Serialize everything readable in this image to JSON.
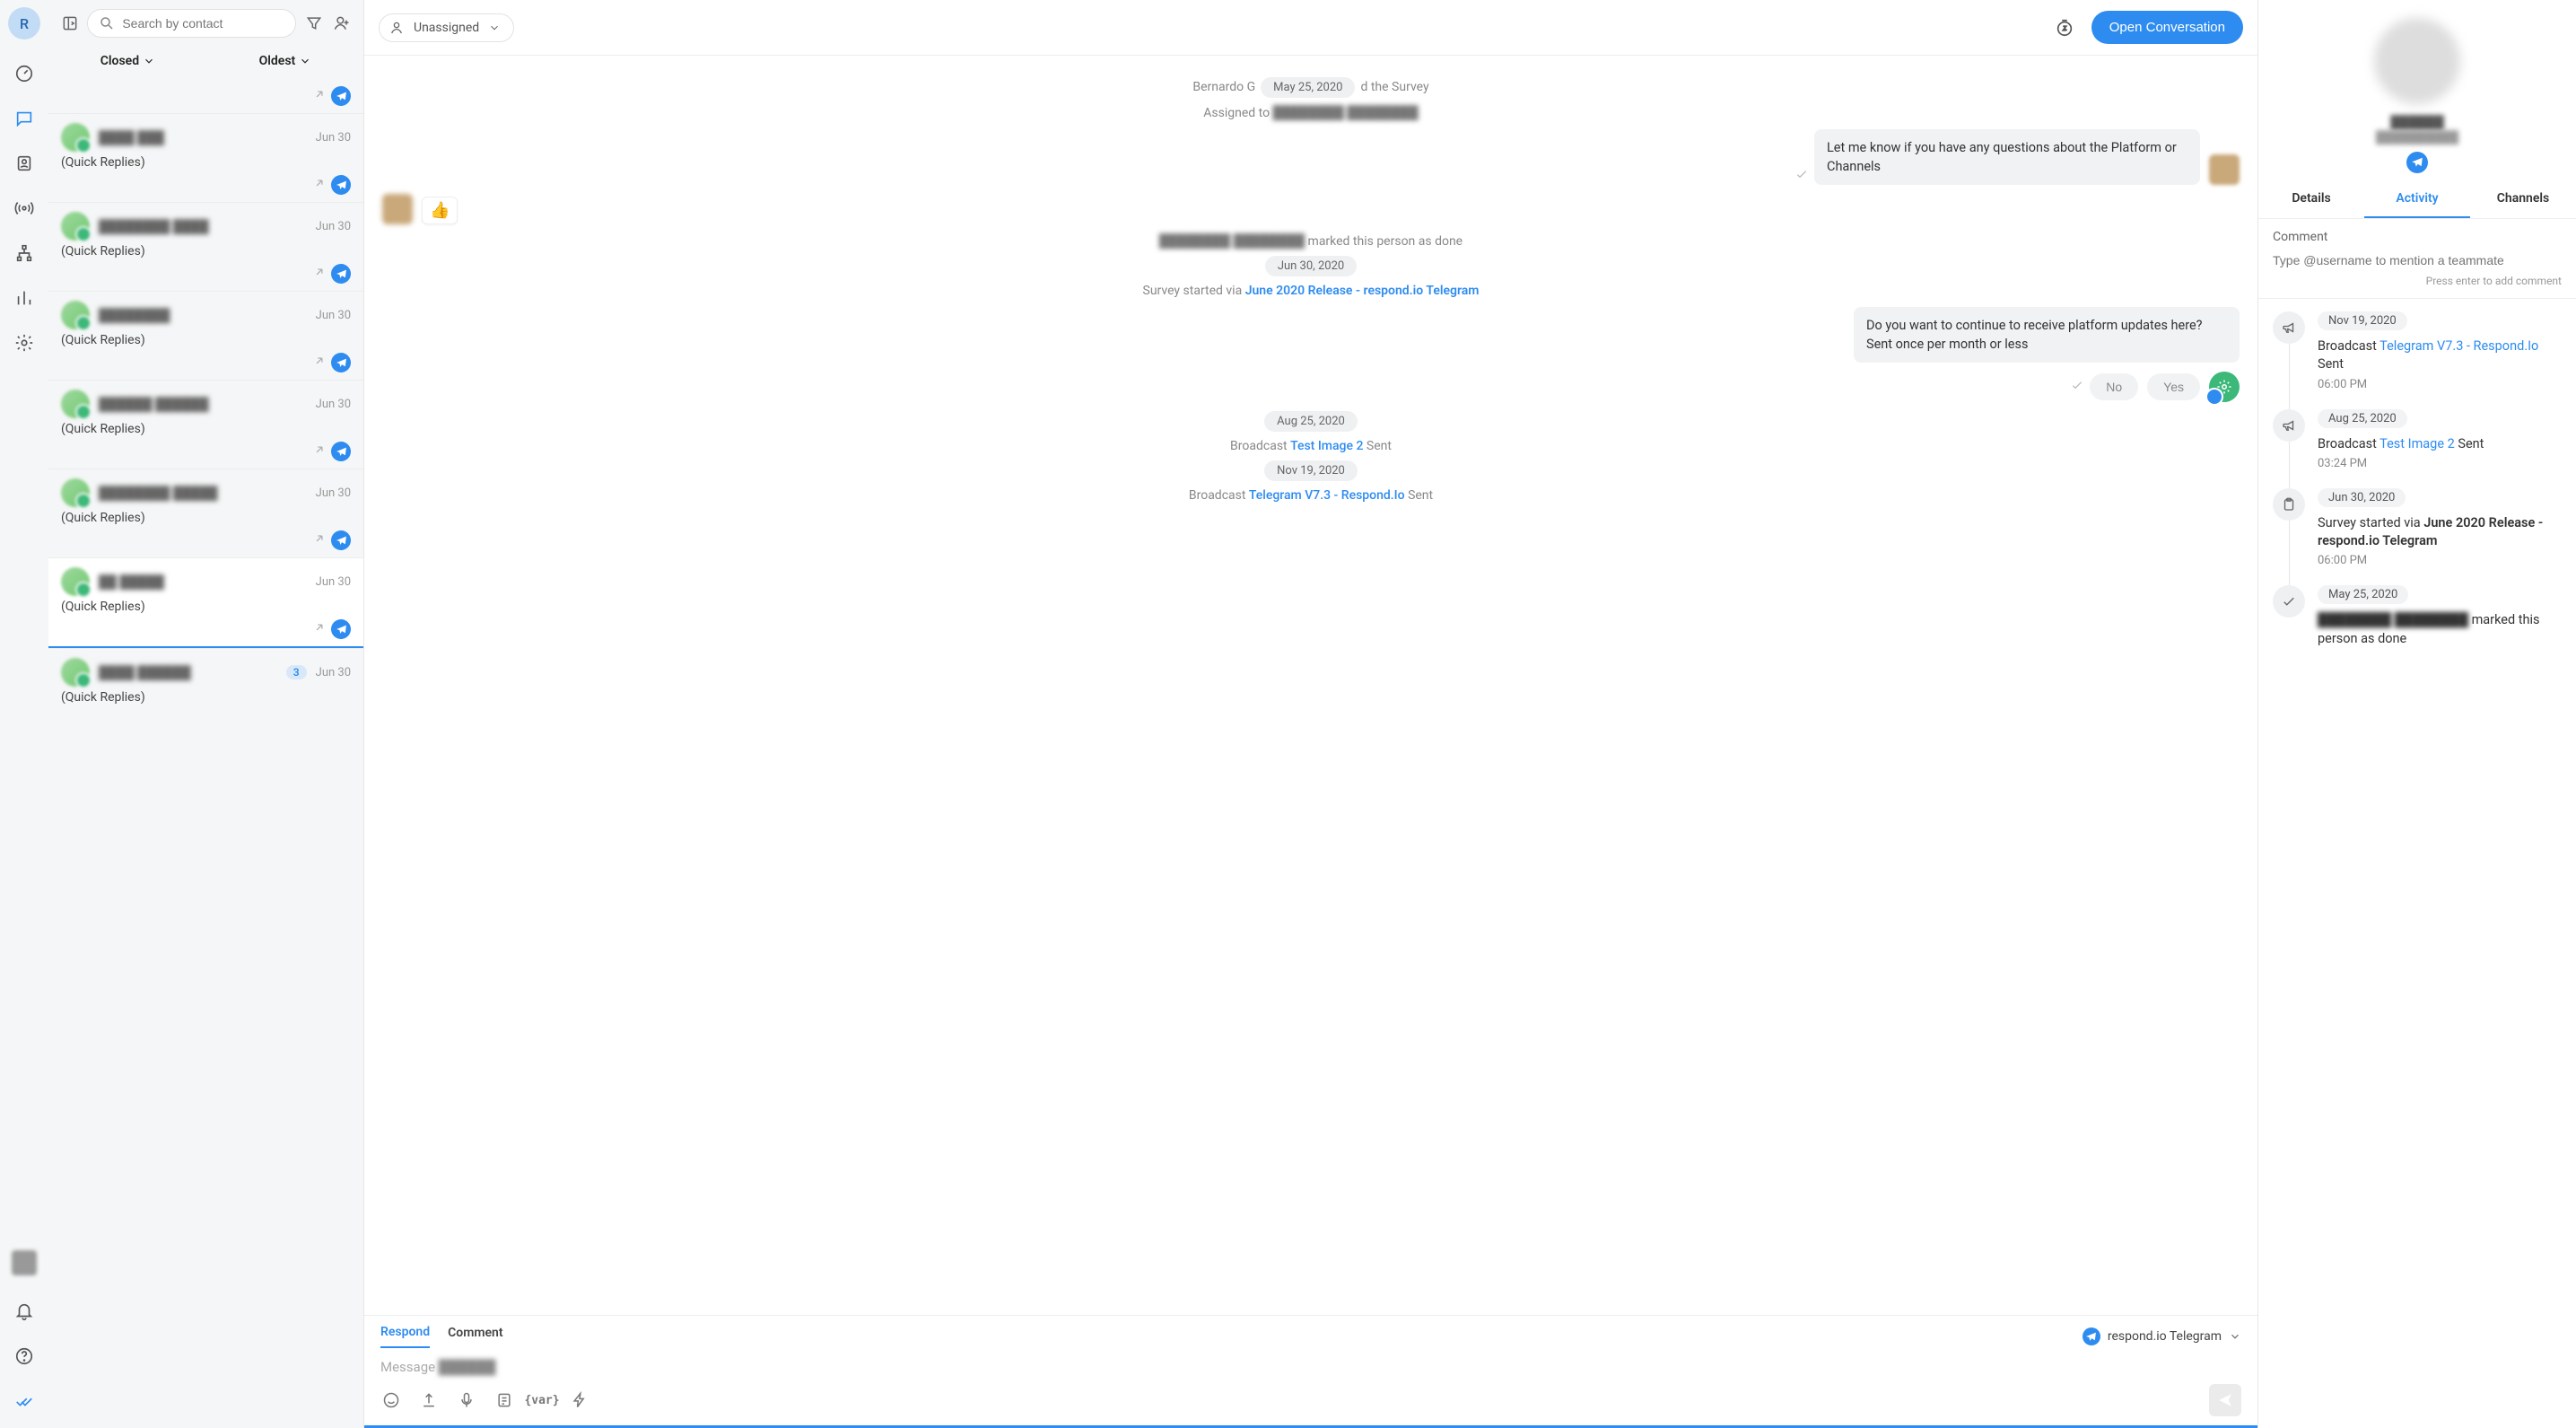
{
  "user_initial": "R",
  "search": {
    "placeholder": "Search by contact"
  },
  "filters": {
    "status": "Closed",
    "sort": "Oldest"
  },
  "contacts": [
    {
      "name": "████ ███",
      "date": "Jun 30",
      "preview": "(Quick Replies)"
    },
    {
      "name": "████████ ████",
      "date": "Jun 30",
      "preview": "(Quick Replies)"
    },
    {
      "name": "████████",
      "date": "Jun 30",
      "preview": "(Quick Replies)"
    },
    {
      "name": "██████ ██████",
      "date": "Jun 30",
      "preview": "(Quick Replies)"
    },
    {
      "name": "████████ █████",
      "date": "Jun 30",
      "preview": "(Quick Replies)"
    },
    {
      "name": "██ █████",
      "date": "Jun 30",
      "preview": "(Quick Replies)"
    },
    {
      "name": "████ ██████",
      "date": "Jun 30",
      "preview": "(Quick Replies)",
      "badge": "3"
    }
  ],
  "convo": {
    "assignee": "Unassigned",
    "open_btn": "Open Conversation",
    "floating_date": "May 25, 2020",
    "survey_line_prefix": "Bernardo G",
    "survey_line_suffix": "d the Survey",
    "assigned_prefix": "Assigned to ",
    "assigned_name": "████████ ████████",
    "msg1": "Let me know if you have any questions about the Platform or Channels",
    "reaction": "👍",
    "done_name": "████████ ████████",
    "done_suffix": " marked this person as done",
    "date2": "Jun 30, 2020",
    "survey_started_prefix": "Survey started via ",
    "survey_started_link": "June 2020 Release - respond.io Telegram",
    "msg2": "Do you want to continue to receive platform updates here? Sent once per month or less",
    "no": "No",
    "yes": "Yes",
    "date3": "Aug 25, 2020",
    "bc1_prefix": "Broadcast ",
    "bc1_link": "Test Image 2",
    "bc1_suffix": " Sent",
    "date4": "Nov 19, 2020",
    "bc2_prefix": "Broadcast ",
    "bc2_link": "Telegram V7.3 - Respond.Io",
    "bc2_suffix": " Sent"
  },
  "composer": {
    "tab_respond": "Respond",
    "tab_comment": "Comment",
    "channel": "respond.io Telegram",
    "placeholder": "Message ",
    "placeholder_name": "██████",
    "var_label": "{var}"
  },
  "details": {
    "name": "██████",
    "sub": "██████████",
    "tabs": {
      "details": "Details",
      "activity": "Activity",
      "channels": "Channels"
    },
    "comment_label": "Comment",
    "comment_placeholder": "Type @username to mention a teammate",
    "comment_hint": "Press enter to add comment"
  },
  "activity": [
    {
      "date": "Nov 19, 2020",
      "icon": "megaphone",
      "text_pre": "Broadcast ",
      "link": "Telegram V7.3 - Respond.Io",
      "text_post": " Sent",
      "time": "06:00 PM"
    },
    {
      "date": "Aug 25, 2020",
      "icon": "megaphone",
      "text_pre": "Broadcast ",
      "link": "Test Image 2",
      "text_post": " Sent",
      "time": "03:24 PM"
    },
    {
      "date": "Jun 30, 2020",
      "icon": "clipboard",
      "text_pre": "Survey started via ",
      "bold": "June 2020 Release - respond.io Telegram",
      "time": "06:00 PM"
    },
    {
      "date": "May 25, 2020",
      "icon": "check",
      "blurred": "████████ ████████",
      "text_post": " marked this person as done"
    }
  ]
}
